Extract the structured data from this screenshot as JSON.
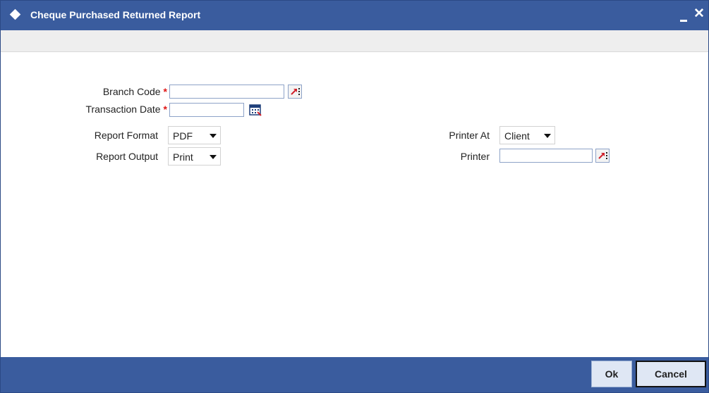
{
  "window": {
    "title": "Cheque Purchased Returned Report"
  },
  "form": {
    "branch_code": {
      "label": "Branch Code",
      "required_mark": "*",
      "value": ""
    },
    "transaction_date": {
      "label": "Transaction Date",
      "required_mark": "*",
      "value": ""
    },
    "report_format": {
      "label": "Report Format",
      "selected": "PDF"
    },
    "report_output": {
      "label": "Report Output",
      "selected": "Print"
    },
    "printer_at": {
      "label": "Printer At",
      "selected": "Client"
    },
    "printer": {
      "label": "Printer",
      "value": ""
    }
  },
  "buttons": {
    "ok": "Ok",
    "cancel": "Cancel"
  },
  "colors": {
    "titlebar": "#3a5c9e",
    "required": "#e01616",
    "lov_icon": "#d0202a",
    "button_bg": "#dfe7f4"
  },
  "icons": {
    "title": "diamond-icon",
    "minimize": "minimize-icon",
    "close": "close-icon",
    "lov": "list-of-values-icon",
    "calendar": "calendar-icon"
  }
}
